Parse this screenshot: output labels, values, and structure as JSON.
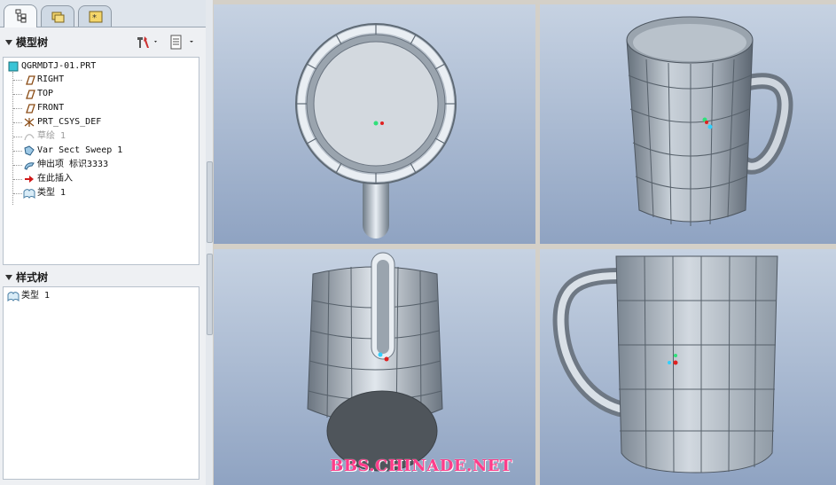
{
  "left_panel": {
    "tabs": [
      {
        "name": "model-tree-tab",
        "icon": "model-tree-icon",
        "active": true
      },
      {
        "name": "folder-browser-tab",
        "icon": "folder-icon",
        "active": false
      },
      {
        "name": "favorites-tab",
        "icon": "favorites-icon",
        "active": false
      }
    ],
    "model_tree": {
      "title": "模型树",
      "items": [
        {
          "label": "QGRMDTJ-01.PRT",
          "icon": "part-icon",
          "dim": false
        },
        {
          "label": "RIGHT",
          "icon": "datum-plane-icon",
          "dim": false
        },
        {
          "label": "TOP",
          "icon": "datum-plane-icon",
          "dim": false
        },
        {
          "label": "FRONT",
          "icon": "datum-plane-icon",
          "dim": false
        },
        {
          "label": "PRT_CSYS_DEF",
          "icon": "coordinate-system-icon",
          "dim": false
        },
        {
          "label": "草绘 1",
          "icon": "sketch-icon",
          "dim": true
        },
        {
          "label": "Var Sect Sweep 1",
          "icon": "sweep-icon",
          "dim": false
        },
        {
          "label": "伸出项 标识3333",
          "icon": "protrusion-icon",
          "dim": false
        },
        {
          "label": "在此插入",
          "icon": "insert-here-arrow-icon",
          "dim": false
        },
        {
          "label": "类型 1",
          "icon": "style-icon",
          "dim": false
        }
      ]
    },
    "style_tree": {
      "title": "样式树",
      "items": [
        {
          "label": "类型 1",
          "icon": "style-icon"
        }
      ]
    }
  },
  "watermark": "BBS.CHINADE.NET",
  "colors": {
    "viewport_top": "#c6d2e2",
    "viewport_bottom": "#8fa3c2",
    "watermark": "#ff3d8a"
  }
}
